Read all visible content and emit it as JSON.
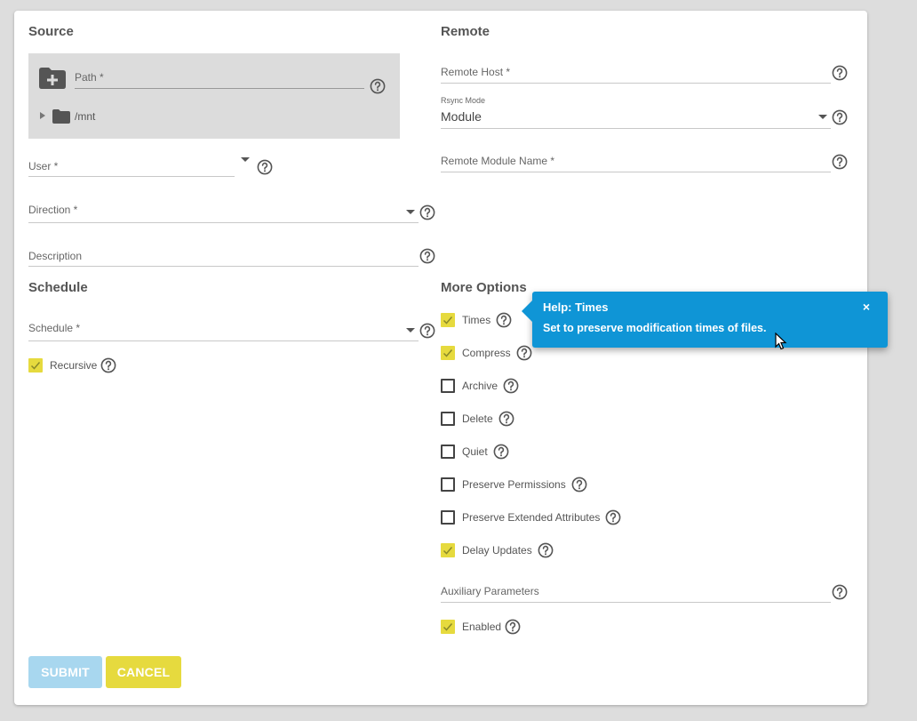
{
  "source": {
    "title": "Source",
    "path_label": "Path *",
    "tree_item": "/mnt",
    "user_label": "User *",
    "direction_label": "Direction *",
    "description_label": "Description"
  },
  "remote": {
    "title": "Remote",
    "host_label": "Remote Host *",
    "rsync_mode_label": "Rsync Mode",
    "rsync_mode_value": "Module",
    "module_name_label": "Remote Module Name *"
  },
  "schedule": {
    "title": "Schedule",
    "schedule_label": "Schedule *",
    "recursive_label": "Recursive",
    "recursive_checked": true
  },
  "more_options": {
    "title": "More Options",
    "options": [
      {
        "label": "Times",
        "checked": true
      },
      {
        "label": "Compress",
        "checked": true
      },
      {
        "label": "Archive",
        "checked": false
      },
      {
        "label": "Delete",
        "checked": false
      },
      {
        "label": "Quiet",
        "checked": false
      },
      {
        "label": "Preserve Permissions",
        "checked": false
      },
      {
        "label": "Preserve Extended Attributes",
        "checked": false
      },
      {
        "label": "Delay Updates",
        "checked": true
      }
    ],
    "aux_label": "Auxiliary Parameters",
    "enabled_label": "Enabled",
    "enabled_checked": true
  },
  "buttons": {
    "submit": "SUBMIT",
    "cancel": "CANCEL"
  },
  "tooltip": {
    "title": "Help: Times",
    "body": "Set to preserve modification times of files.",
    "close": "×"
  },
  "colors": {
    "accent_yellow": "#e6da3e",
    "primary_blue": "#0f95d6",
    "submit_disabled": "#a8d7ef"
  }
}
